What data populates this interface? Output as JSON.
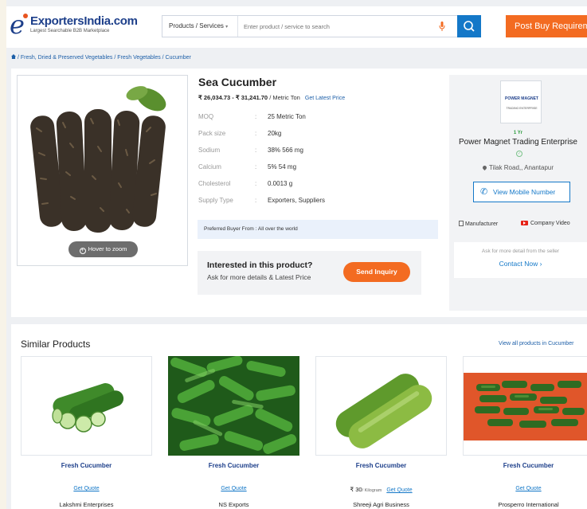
{
  "header": {
    "logo_name": "ExportersIndia.com",
    "logo_tagline": "Largest Searchable B2B Marketplace",
    "search_category": "Products / Services",
    "search_placeholder": "Enter product / service to search",
    "post_button": "Post Buy Requirement"
  },
  "breadcrumb": {
    "text": "/ Fresh, Dried & Preserved Vegetables / Fresh Vegetables / Cucumber"
  },
  "product": {
    "title": "Sea Cucumber",
    "price_range": "₹ 26,034.73 - ₹ 31,241.70",
    "price_unit": "/ Metric Ton",
    "latest_price_link": "Get Latest Price",
    "hover_zoom": "Hover to zoom",
    "specs": [
      {
        "label": "MOQ",
        "value": "25 Metric Ton"
      },
      {
        "label": "Pack size",
        "value": "20kg"
      },
      {
        "label": "Sodium",
        "value": "38% 566 mg"
      },
      {
        "label": "Calcium",
        "value": "5% 54 mg"
      },
      {
        "label": "Cholesterol",
        "value": "0.0013 g"
      },
      {
        "label": "Supply Type",
        "value": "Exporters, Suppliers"
      }
    ],
    "spec_separator": ":",
    "preferred_buyer": "Preferred Buyer From : All over the world",
    "interest_title": "Interested in this product?",
    "interest_subtitle": "Ask for more details & Latest Price",
    "send_inquiry": "Send Inquiry"
  },
  "seller": {
    "logo_text": "POWER MAGNET",
    "logo_subtext": "TRADING ENTERPRISE",
    "years": "1 Yr",
    "name": "Power Magnet Trading Enterprise",
    "address": "Tilak Road,, Anantapur",
    "mobile_button": "View Mobile Number",
    "manufacturer": "Manufacturer",
    "company_video": "Company Video",
    "more_detail": "Ask for more detail from the seller",
    "contact_now": "Contact Now ›"
  },
  "similar": {
    "title": "Similar Products",
    "view_all": "View all products in Cucumber",
    "items": [
      {
        "name": "Fresh Cucumber",
        "price": "",
        "price_unit": "",
        "quote": "Get Quote",
        "company": "Lakshmi Enterprises"
      },
      {
        "name": "Fresh Cucumber",
        "price": "",
        "price_unit": "",
        "quote": "Get Quote",
        "company": "NS Exports"
      },
      {
        "name": "Fresh Cucumber",
        "price": "₹ 30",
        "price_unit": "/ Kilogram",
        "quote": "Get Quote",
        "company": "Shreeji Agri Business"
      },
      {
        "name": "Fresh Cucumber",
        "price": "",
        "price_unit": "",
        "quote": "Get Quote",
        "company": "Prosperro International"
      }
    ]
  },
  "colors": {
    "brand_blue": "#1d3f8a",
    "accent_orange": "#f36b21",
    "link_blue": "#1478c8"
  }
}
